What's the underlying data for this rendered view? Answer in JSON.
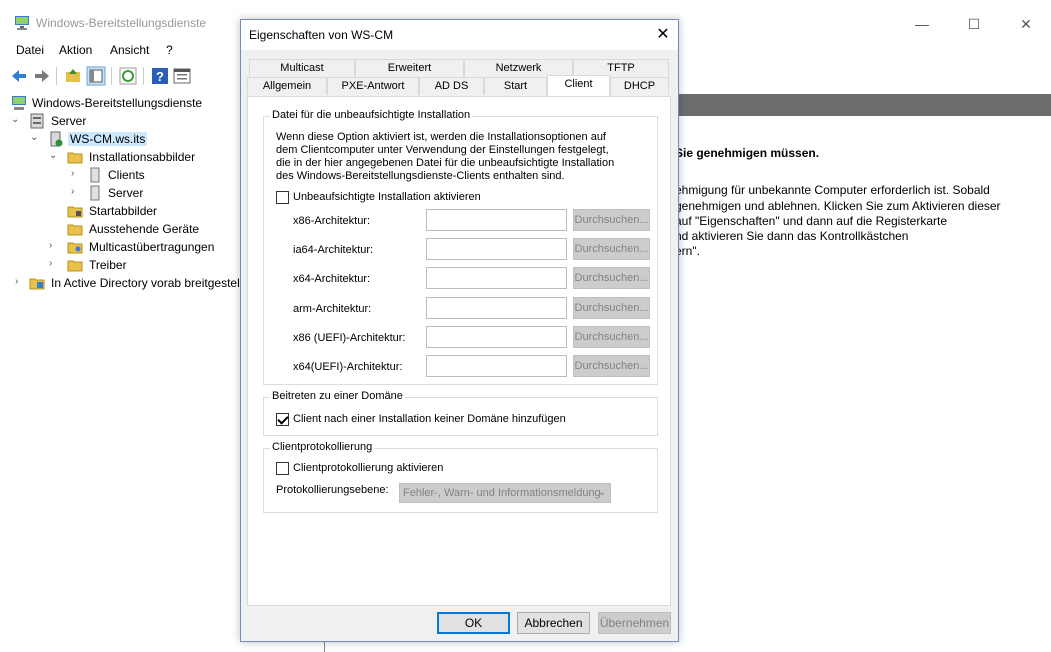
{
  "app": {
    "title": "Windows-Bereitstellungsdienste",
    "menu": [
      "Datei",
      "Aktion",
      "Ansicht",
      "?"
    ]
  },
  "tree": {
    "root": "Windows-Bereitstellungsdienste",
    "server": "Server",
    "host": "WS-CM.ws.its",
    "install_images": "Installationsabbilder",
    "clients": "Clients",
    "server_child": "Server",
    "boot_images": "Startabbilder",
    "pending_devices": "Ausstehende Geräte",
    "multicast": "Multicastübertragungen",
    "drivers": "Treiber",
    "ad_prestaged": "In Active Directory vorab breitgestel"
  },
  "details": {
    "bold_line": "Sie genehmigen müssen.",
    "lines": [
      "ehmigung für unbekannte Computer erforderlich ist. Sobald",
      "genehmigen und ablehnen. Klicken Sie zum Aktivieren dieser",
      " auf \"Eigenschaften\" und dann auf die Registerkarte",
      "nd aktivieren Sie dann das Kontrollkästchen",
      "ern\"."
    ]
  },
  "dialog": {
    "title": "Eigenschaften von WS-CM",
    "tabs_row1": [
      "Multicast",
      "Erweitert",
      "Netzwerk",
      "TFTP"
    ],
    "tabs_row2": [
      "Allgemein",
      "PXE-Antwort",
      "AD DS",
      "Start",
      "Client",
      "DHCP"
    ],
    "active_tab": "Client",
    "unattend": {
      "title": "Datei für die unbeaufsichtigte Installation",
      "description": [
        "Wenn diese Option aktiviert ist, werden die Installationsoptionen auf",
        "dem Clientcomputer unter Verwendung der Einstellungen festgelegt,",
        "die in der hier angegebenen Datei für die unbeaufsichtigte Installation",
        "des Windows-Bereitstellungsdienste-Clients enthalten sind."
      ],
      "enable_label": "Unbeaufsichtigte Installation aktivieren",
      "enabled": false,
      "browse_label": "Durchsuchen...",
      "architectures": [
        {
          "label": "x86-Architektur:",
          "value": ""
        },
        {
          "label": "ia64-Architektur:",
          "value": ""
        },
        {
          "label": "x64-Architektur:",
          "value": ""
        },
        {
          "label": "arm-Architektur:",
          "value": ""
        },
        {
          "label": "x86 (UEFI)-Architektur:",
          "value": ""
        },
        {
          "label": "x64(UEFI)-Architektur:",
          "value": ""
        }
      ]
    },
    "domain": {
      "title": "Beitreten zu einer Domäne",
      "checkbox_label": "Client nach einer Installation keiner Domäne hinzufügen",
      "checked": true
    },
    "logging": {
      "title": "Clientprotokollierung",
      "checkbox_label": "Clientprotokollierung aktivieren",
      "checked": false,
      "level_label": "Protokollierungsebene:",
      "level_value": "Fehler-, Warn- und Informationsmeldung"
    },
    "buttons": {
      "ok": "OK",
      "cancel": "Abbrechen",
      "apply": "Übernehmen"
    }
  }
}
